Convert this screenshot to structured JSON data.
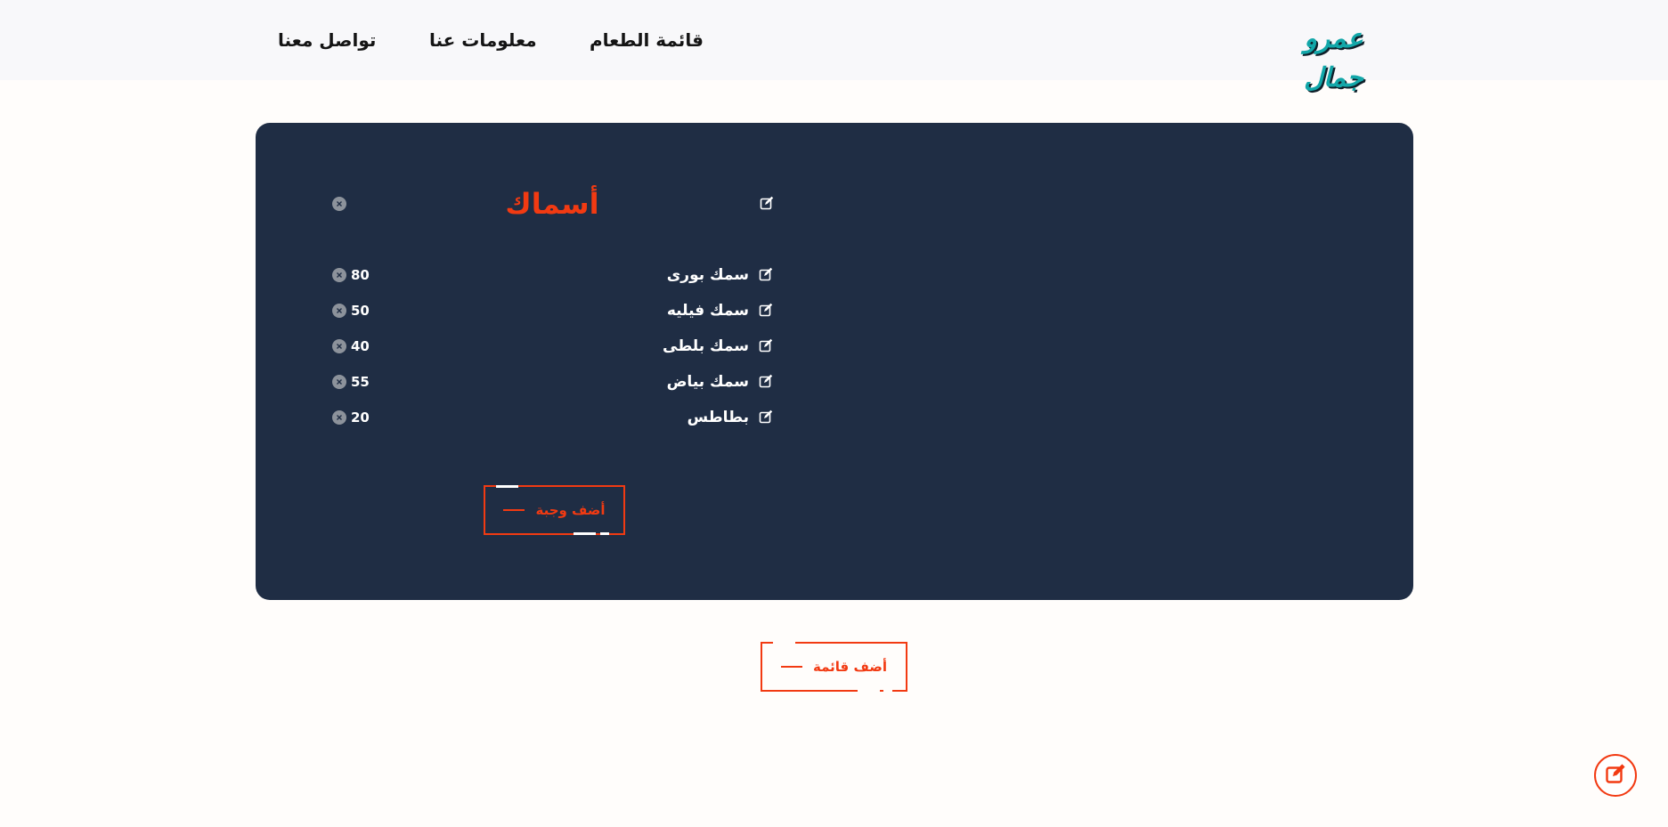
{
  "header": {
    "logo": "عمرو جمال",
    "nav": [
      "قائمة الطعام",
      "معلومات عنا",
      "تواصل معنا"
    ]
  },
  "section": {
    "title": "أسماك",
    "items": [
      {
        "name": "سمك بورى",
        "price": "80"
      },
      {
        "name": "سمك فيليه",
        "price": "50"
      },
      {
        "name": "سمك بلطى",
        "price": "40"
      },
      {
        "name": "سمك بياض",
        "price": "55"
      },
      {
        "name": "بطاطس",
        "price": "20"
      }
    ],
    "add_meal_label": "أضف وجبة"
  },
  "add_list_label": "أضف قائمة",
  "colors": {
    "accent": "#f23a12",
    "card_bg": "#1f2d44",
    "logo": "#12a7a9",
    "header_bg": "#f8f8fa"
  },
  "icons": {
    "edit": "edit-icon",
    "close": "close-circle-icon",
    "fab": "edit-icon"
  }
}
